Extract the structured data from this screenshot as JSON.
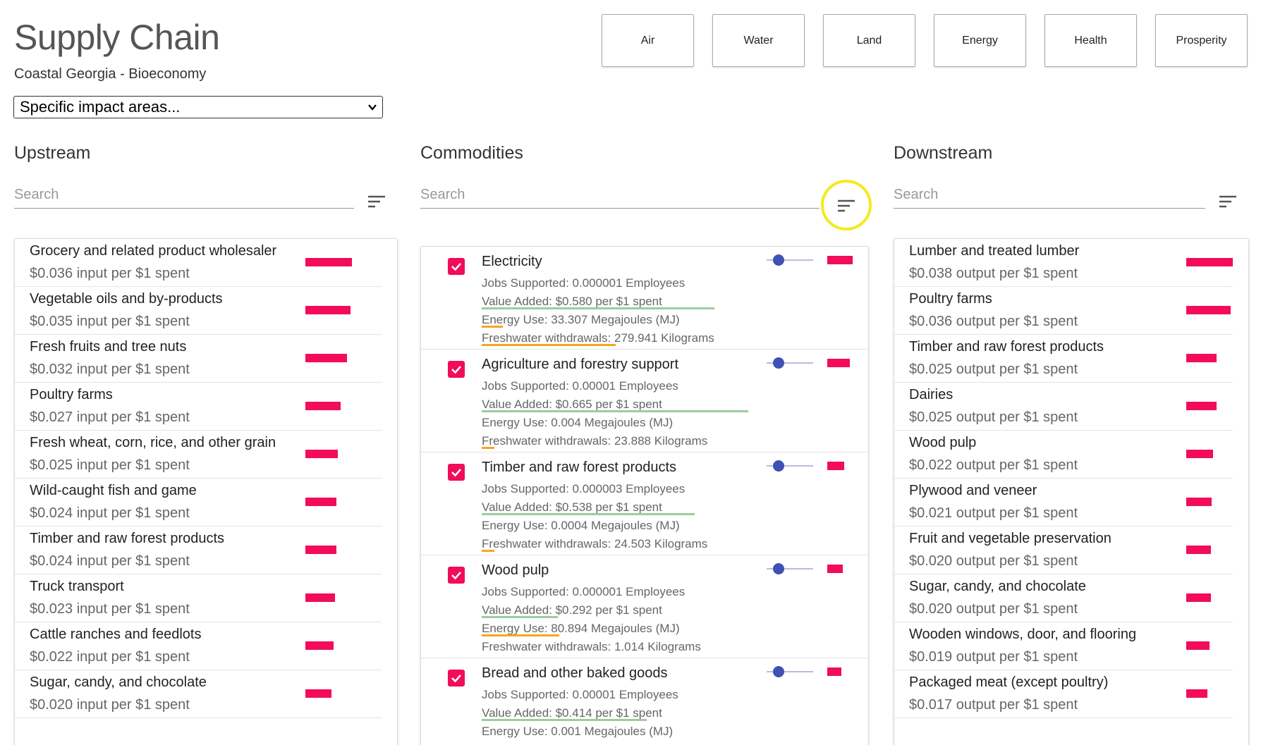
{
  "header": {
    "title": "Supply Chain",
    "subtitle": "Coastal Georgia - Bioeconomy",
    "select_value": "Specific impact areas..."
  },
  "impact_buttons": [
    "Air",
    "Water",
    "Land",
    "Energy",
    "Health",
    "Prosperity"
  ],
  "upstream": {
    "title": "Upstream",
    "search_placeholder": "Search",
    "items": [
      {
        "name": "Grocery and related product wholesaler",
        "value": "$0.036 input per $1 spent",
        "level": 0.036
      },
      {
        "name": "Vegetable oils and by-products",
        "value": "$0.035 input per $1 spent",
        "level": 0.035
      },
      {
        "name": "Fresh fruits and tree nuts",
        "value": "$0.032 input per $1 spent",
        "level": 0.032
      },
      {
        "name": "Poultry farms",
        "value": "$0.027 input per $1 spent",
        "level": 0.027
      },
      {
        "name": "Fresh wheat, corn, rice, and other grain",
        "value": "$0.025 input per $1 spent",
        "level": 0.025
      },
      {
        "name": "Wild-caught fish and game",
        "value": "$0.024 input per $1 spent",
        "level": 0.024
      },
      {
        "name": "Timber and raw forest products",
        "value": "$0.024 input per $1 spent",
        "level": 0.024
      },
      {
        "name": "Truck transport",
        "value": "$0.023 input per $1 spent",
        "level": 0.023
      },
      {
        "name": "Cattle ranches and feedlots",
        "value": "$0.022 input per $1 spent",
        "level": 0.022
      },
      {
        "name": "Sugar, candy, and chocolate",
        "value": "$0.020 input per $1 spent",
        "level": 0.02
      }
    ]
  },
  "commodities": {
    "title": "Commodities",
    "search_placeholder": "Search",
    "items": [
      {
        "name": "Electricity",
        "jobs": "Jobs Supported: 0.000001 Employees",
        "value_added": "Value Added: $0.580 per $1 spent",
        "energy": "Energy Use: 33.307 Megajoules (MJ)",
        "water": "Freshwater withdrawals: 279.941 Kilograms",
        "bar_level": 0.9,
        "slider_level": 0.25
      },
      {
        "name": "Agriculture and forestry support",
        "jobs": "Jobs Supported: 0.00001 Employees",
        "value_added": "Value Added: $0.665 per $1 spent",
        "energy": "Energy Use: 0.004 Megajoules (MJ)",
        "water": "Freshwater withdrawals: 23.888 Kilograms",
        "bar_level": 0.8,
        "slider_level": 0.25
      },
      {
        "name": "Timber and raw forest products",
        "jobs": "Jobs Supported: 0.000003 Employees",
        "value_added": "Value Added: $0.538 per $1 spent",
        "energy": "Energy Use: 0.0004 Megajoules (MJ)",
        "water": "Freshwater withdrawals: 24.503 Kilograms",
        "bar_level": 0.6,
        "slider_level": 0.25
      },
      {
        "name": "Wood pulp",
        "jobs": "Jobs Supported: 0.000001 Employees",
        "value_added": "Value Added: $0.292 per $1 spent",
        "energy": "Energy Use: 80.894 Megajoules (MJ)",
        "water": "Freshwater withdrawals: 1.014 Kilograms",
        "bar_level": 0.55,
        "slider_level": 0.25
      },
      {
        "name": "Bread and other baked goods",
        "jobs": "Jobs Supported: 0.00001 Employees",
        "value_added": "Value Added: $0.414 per $1 spent",
        "energy": "Energy Use: 0.001 Megajoules (MJ)",
        "water": "",
        "bar_level": 0.5,
        "slider_level": 0.25
      }
    ]
  },
  "downstream": {
    "title": "Downstream",
    "search_placeholder": "Search",
    "items": [
      {
        "name": "Lumber and treated lumber",
        "value": "$0.038 output per $1 spent",
        "level": 0.038
      },
      {
        "name": "Poultry farms",
        "value": "$0.036 output per $1 spent",
        "level": 0.036
      },
      {
        "name": "Timber and raw forest products",
        "value": "$0.025 output per $1 spent",
        "level": 0.025
      },
      {
        "name": "Dairies",
        "value": "$0.025 output per $1 spent",
        "level": 0.025
      },
      {
        "name": "Wood pulp",
        "value": "$0.022 output per $1 spent",
        "level": 0.022
      },
      {
        "name": "Plywood and veneer",
        "value": "$0.021 output per $1 spent",
        "level": 0.021
      },
      {
        "name": "Fruit and vegetable preservation",
        "value": "$0.020 output per $1 spent",
        "level": 0.02
      },
      {
        "name": "Sugar, candy, and chocolate",
        "value": "$0.020 output per $1 spent",
        "level": 0.02
      },
      {
        "name": "Wooden windows, door, and flooring",
        "value": "$0.019 output per $1 spent",
        "level": 0.019
      },
      {
        "name": "Packaged meat (except poultry)",
        "value": "$0.017 output per $1 spent",
        "level": 0.017
      }
    ]
  },
  "colors": {
    "accent_bar": "#f20c5a",
    "slider": "#3f51b5",
    "value_underline": "#9ccc9f",
    "energy_underline": "#f5a623",
    "highlight": "#f4ea1f"
  }
}
